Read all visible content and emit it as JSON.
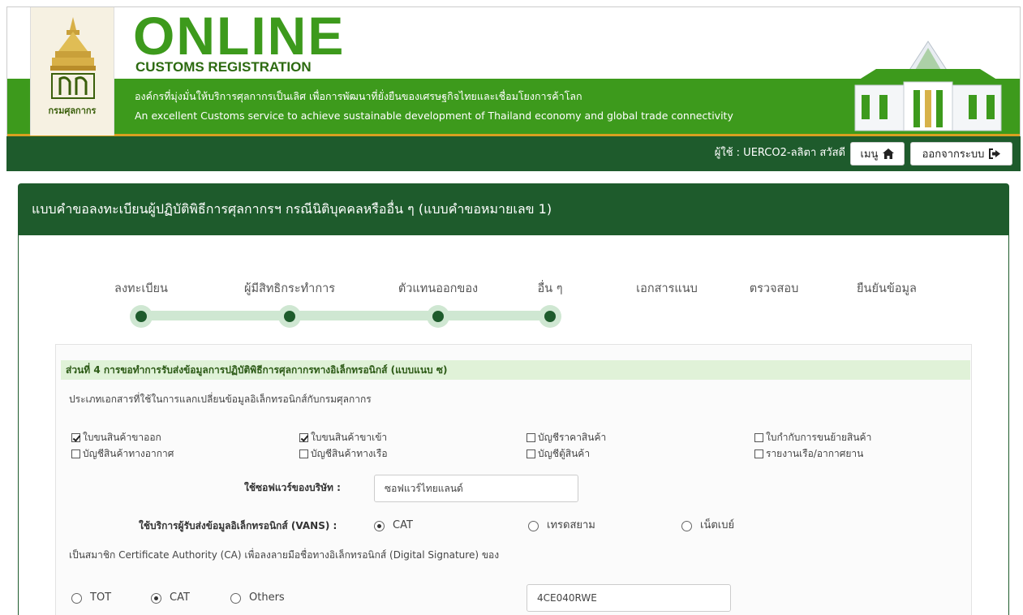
{
  "header": {
    "department_logo_text": "กรมศุลกากร",
    "brand_title": "ONLINE",
    "brand_subtitle": "CUSTOMS REGISTRATION",
    "slogan_th": "องค์กรที่มุ่งมั่นให้บริการศุลกากรเป็นเลิศ เพื่อการพัฒนาที่ยั่งยืนของเศรษฐกิจไทยและเชื่อมโยงการค้าโลก",
    "slogan_en": "An excellent Customs service to achieve sustainable development of Thailand economy and global trade connectivity",
    "colors": {
      "green": "#3d9a1c",
      "dark_green": "#1e5b2c",
      "orange": "#d9a020"
    }
  },
  "userbar": {
    "user_label": "ผู้ใช้ : UERCO2-ลลิตา สวัสดี",
    "menu_label": "เมนู",
    "menu_icon": "home-icon",
    "logout_label": "ออกจากระบบ",
    "logout_icon": "sign-out-icon"
  },
  "panel": {
    "title": "แบบคำขอลงทะเบียนผู้ปฏิบัติพิธีการศุลกากรฯ กรณีนิติบุคคลหรืออื่น ๆ (แบบคำขอหมายเลข 1)"
  },
  "steps": [
    {
      "label": "ลงทะเบียน",
      "completed": true
    },
    {
      "label": "ผู้มีสิทธิกระทำการ",
      "completed": true
    },
    {
      "label": "ตัวแทนออกของ",
      "completed": true
    },
    {
      "label": "อื่น ๆ",
      "completed": true
    },
    {
      "label": "เอกสารแนบ",
      "completed": false
    },
    {
      "label": "ตรวจสอบ",
      "completed": false
    },
    {
      "label": "ยืนยันข้อมูล",
      "completed": false
    }
  ],
  "section4": {
    "title": "ส่วนที่ 4 การขอทำการรับส่งข้อมูลการปฏิบัติพิธีการศุลกากรทางอิเล็กทรอนิกส์ (แบบแนบ ซ)",
    "doc_types_label": "ประเภทเอกสารที่ใช้ในการแลกเปลี่ยนข้อมูลอิเล็กทรอนิกส์กับกรมศุลกากร",
    "doc_types": [
      {
        "label": "ใบขนสินค้าขาออก",
        "checked": true
      },
      {
        "label": "ใบขนสินค้าขาเข้า",
        "checked": true
      },
      {
        "label": "บัญชีราคาสินค้า",
        "checked": false
      },
      {
        "label": "ใบกำกับการขนย้ายสินค้า",
        "checked": false
      },
      {
        "label": "บัญชีสินค้าทางอากาศ",
        "checked": false
      },
      {
        "label": "บัญชีสินค้าทางเรือ",
        "checked": false
      },
      {
        "label": "บัญชีตู้สินค้า",
        "checked": false
      },
      {
        "label": "รายงานเรือ/อากาศยาน",
        "checked": false
      }
    ],
    "software_label": "ใช้ซอฟแวร์ของบริษัท :",
    "software_value": "ซอฟแวร์ไทยแลนด์",
    "vans_label": "ใช้บริการผู้รับส่งข้อมูลอิเล็กทรอนิกส์ (VANS) :",
    "vans_options": [
      {
        "label": "CAT",
        "selected": true
      },
      {
        "label": "เทรดสยาม",
        "selected": false
      },
      {
        "label": "เน็ตเบย์",
        "selected": false
      }
    ],
    "ca_label": "เป็นสมาชิก Certificate Authority (CA) เพื่อลงลายมือชื่อทางอิเล็กทรอนิกส์ (Digital Signature) ของ",
    "ca_options": [
      {
        "label": "TOT",
        "selected": false
      },
      {
        "label": "CAT",
        "selected": true
      },
      {
        "label": "Others",
        "selected": false
      }
    ],
    "ca_code_value": "4CE040RWE"
  }
}
